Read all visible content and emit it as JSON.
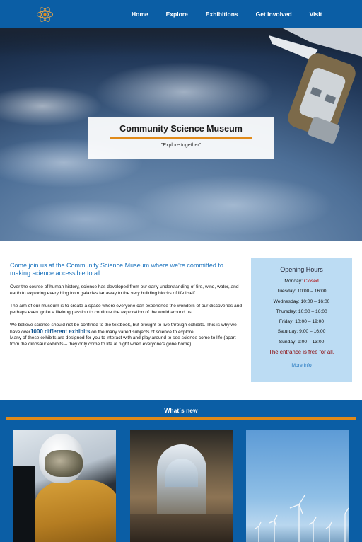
{
  "nav": {
    "logo_icon": "atom-icon",
    "links": [
      "Home",
      "Explore",
      "Exhibitions",
      "Get involved",
      "Visit"
    ]
  },
  "hero": {
    "title": "Community Science Museum",
    "subtitle": "\"Explore together\""
  },
  "intro": {
    "heading": "Come join us at the Community Science Museum where we're committed to making science accessible to all.",
    "p1": "Over the course of human history, science has developed from our early understanding of fire, wind, water, and earth to exploring everything from galaxies far away to the very building blocks of life itself.",
    "p2": "The aim of our museum is to create a space where everyone can experience the wonders of our discoveries and perhaps even ignite a lifelong passion to continue the exploration of the world around us.",
    "p3_a": "We believe science should not be confined to the textbook, but brought to live through exhibits. This is why we have over",
    "p3_highlight": "1000 different exhibits",
    "p3_b": " on the many varied subjects of science to explore.",
    "p4": "Many of these exhibits are designed for you to interact with and play around to see science come to life (apart from the dinosaur exhibits – they only come to life at night when everyone's gone home)."
  },
  "hours": {
    "title": "Opening Hours",
    "days": [
      {
        "day": "Monday: ",
        "time": "Closed",
        "closed": true
      },
      {
        "day": "Tuesday: ",
        "time": "10:00 – 16:00"
      },
      {
        "day": "Wednesday: ",
        "time": "10:00 – 16:00"
      },
      {
        "day": "Thursday: ",
        "time": "10:00 – 16:00"
      },
      {
        "day": "Friday: ",
        "time": "10:00 – 19:00"
      },
      {
        "day": "Saturday: ",
        "time": "9:00 – 16:00"
      },
      {
        "day": "Sunday: ",
        "time": "9:00 – 13:00"
      }
    ],
    "free_note": "The entrance is free for all.",
    "more_link": "More info"
  },
  "news": {
    "title": "What`s new",
    "cards": [
      "astronaut-image",
      "museum-hall-image",
      "wind-turbines-image"
    ]
  },
  "colors": {
    "nav_blue": "#0b5ea5",
    "accent_orange": "#e08a1a",
    "hours_bg": "#bcdcf3",
    "heading_blue": "#1a72bd"
  }
}
